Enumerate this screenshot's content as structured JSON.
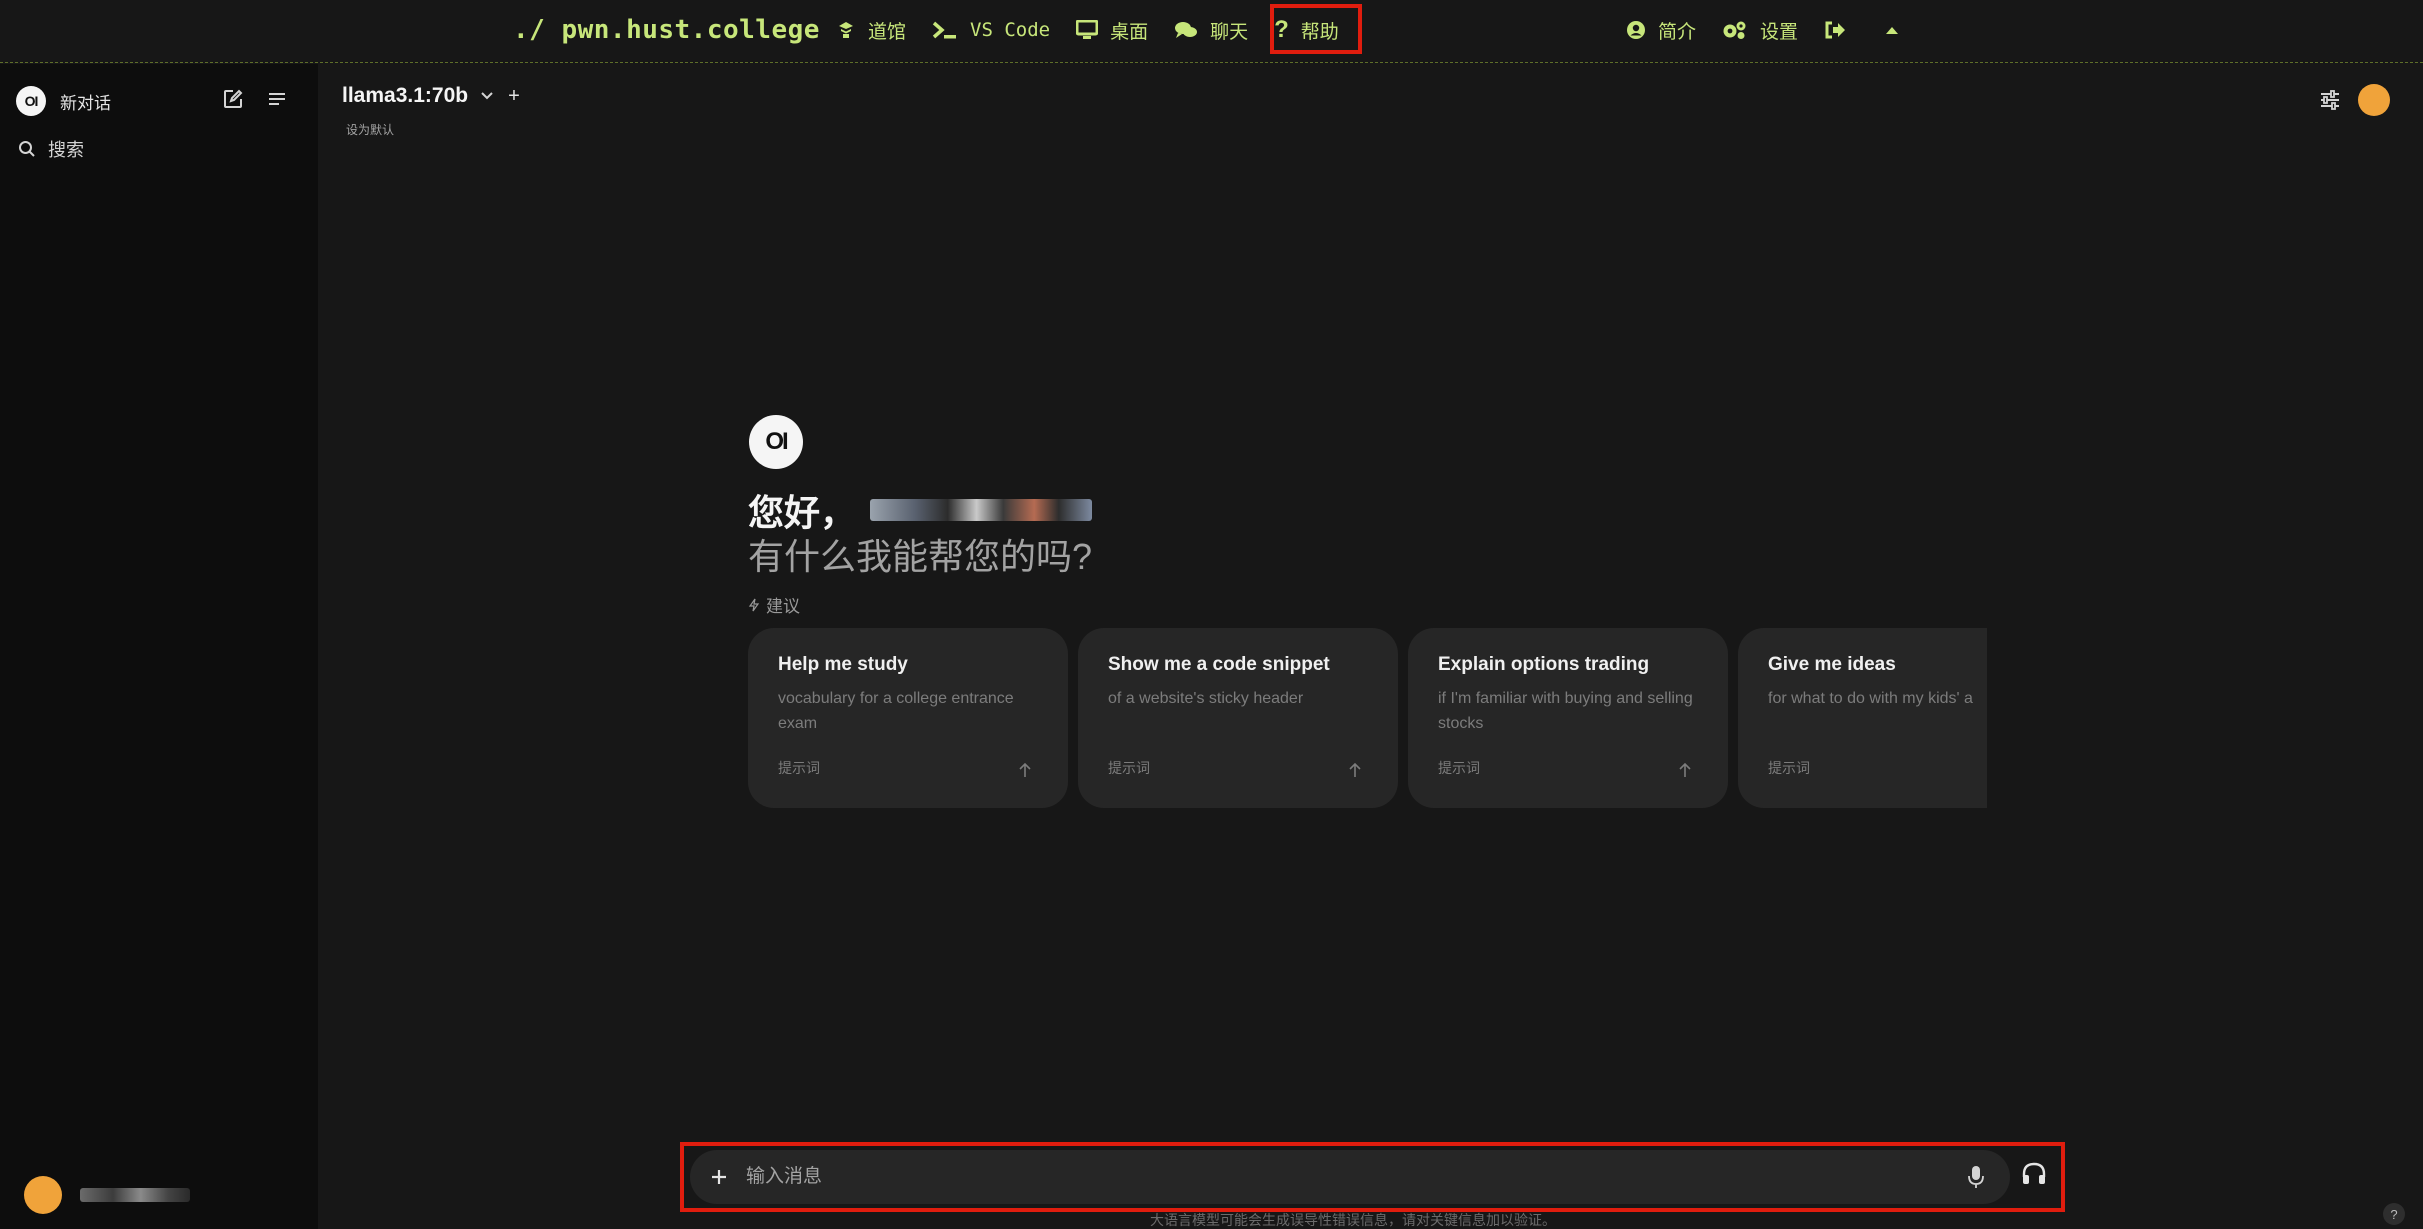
{
  "topbar": {
    "brand": "./ pwn.hust.college",
    "nav_left": [
      {
        "label": "道馆",
        "icon": "dojo-icon"
      },
      {
        "label": "VS Code",
        "icon": "terminal-icon"
      },
      {
        "label": "桌面",
        "icon": "desktop-icon"
      },
      {
        "label": "聊天",
        "icon": "chat-icon"
      },
      {
        "label": "帮助",
        "icon": "question-icon"
      }
    ],
    "nav_right": [
      {
        "label": "简介",
        "icon": "user-circle-icon"
      },
      {
        "label": "设置",
        "icon": "gears-icon"
      },
      {
        "label": "",
        "icon": "logout-icon"
      },
      {
        "label": "",
        "icon": "caret-up-icon"
      }
    ]
  },
  "sidebar": {
    "logo": "OI",
    "new_chat": "新对话",
    "search": "搜索"
  },
  "main": {
    "model": "llama3.1:70b",
    "set_default": "设为默认",
    "hero_logo": "OI",
    "greeting": "您好，",
    "subgreeting": "有什么我能帮您的吗?",
    "suggestions_label": "建议",
    "cards": [
      {
        "title": "Help me study",
        "desc": "vocabulary for a college entrance exam",
        "foot": "提示词"
      },
      {
        "title": "Show me a code snippet",
        "desc": "of a website's sticky header",
        "foot": "提示词"
      },
      {
        "title": "Explain options trading",
        "desc": "if I'm familiar with buying and selling stocks",
        "foot": "提示词"
      },
      {
        "title": "Give me ideas",
        "desc": "for what to do with my kids' a",
        "foot": "提示词"
      }
    ]
  },
  "input": {
    "placeholder": "输入消息"
  },
  "footer": {
    "disclaimer": "大语言模型可能会生成误导性错误信息，请对关键信息加以验证。",
    "help": "?"
  },
  "colors": {
    "accent_green": "#c7e67a",
    "highlight_red": "#e01d0e",
    "avatar_orange": "#f0a33a"
  }
}
